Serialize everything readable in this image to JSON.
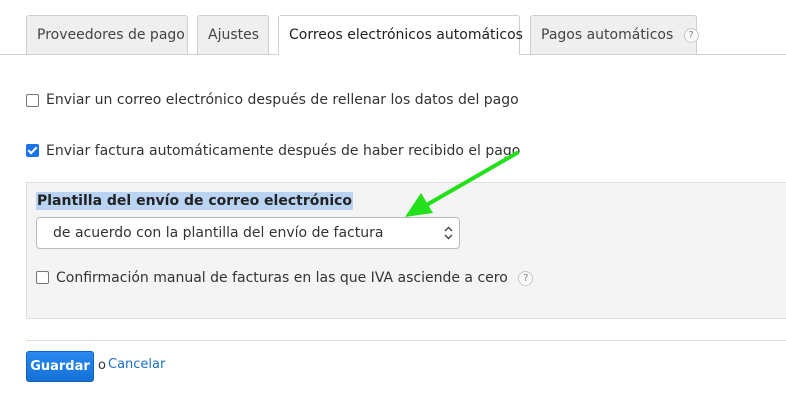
{
  "tabs": {
    "payment_providers": "Proveedores de pago",
    "settings": "Ajustes",
    "auto_emails": "Correos electrónicos automáticos",
    "auto_payments": "Pagos automáticos",
    "help_mark": "?"
  },
  "options": {
    "send_email_after_payment_data": {
      "label": "Enviar un correo electrónico después de rellenar los datos del pago",
      "checked": false
    },
    "send_invoice_after_payment": {
      "label": "Enviar factura automáticamente después de haber recibido el pago",
      "checked": true
    }
  },
  "template_panel": {
    "title": "Plantilla del envío de correo electrónico",
    "select_value": "de acuerdo con la plantilla del envío de factura",
    "manual_confirmation": {
      "label": "Confirmación manual de facturas en las que IVA asciende a cero",
      "checked": false
    },
    "help_mark": "?"
  },
  "actions": {
    "save_label": "Guardar",
    "or_text": "o",
    "cancel_label": "Cancelar"
  },
  "colors": {
    "accent": "#1a73e8",
    "arrow": "#22e01a",
    "link": "#1a6fc9"
  }
}
